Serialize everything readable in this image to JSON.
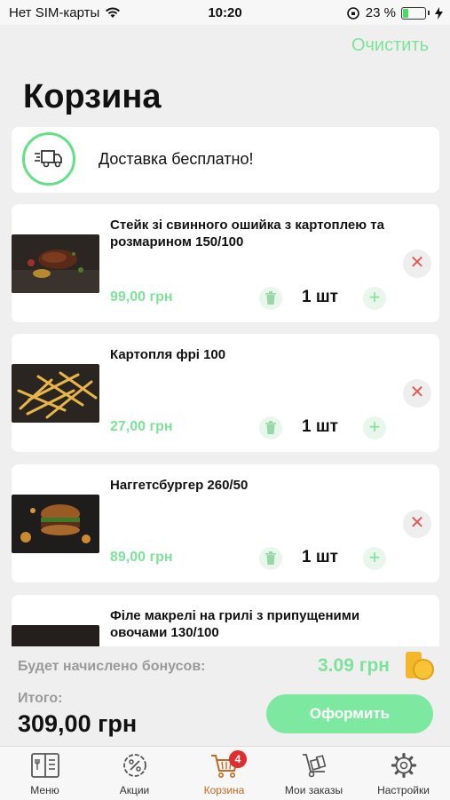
{
  "status_bar": {
    "carrier": "Нет SIM-карты",
    "time": "10:20",
    "battery": "23 %"
  },
  "header": {
    "clear_label": "Очистить",
    "title": "Корзина"
  },
  "delivery": {
    "text": "Доставка бесплатно!"
  },
  "items": [
    {
      "name": "Стейк зі свинного ошийка з  картоплею та розмарином 150/100",
      "price": "99,00 грн",
      "qty": "1 шт"
    },
    {
      "name": "Картопля  фрі 100",
      "price": "27,00 грн",
      "qty": "1 шт"
    },
    {
      "name": "Наггетсбургер 260/50",
      "price": "89,00 грн",
      "qty": "1 шт"
    },
    {
      "name": "Філе макрелі на грилі з припущеними овочами 130/100",
      "price": "",
      "qty": ""
    }
  ],
  "summary": {
    "bonus_label": "Будет начислено бонусов:",
    "bonus_value": "3.09 грн",
    "total_label": "Итого:",
    "total_value": "309,00 грн",
    "checkout_label": "Оформить"
  },
  "tabbar": {
    "items": [
      {
        "label": "Меню",
        "icon": "menu-book-icon"
      },
      {
        "label": "Акции",
        "icon": "percent-badge-icon"
      },
      {
        "label": "Корзина",
        "icon": "cart-icon",
        "badge": "4",
        "active": true
      },
      {
        "label": "Мои заказы",
        "icon": "hand-truck-icon"
      },
      {
        "label": "Настройки",
        "icon": "gear-icon"
      }
    ]
  },
  "colors": {
    "accent_green": "#7de39b",
    "active_tab": "#c2691f",
    "badge_red": "#e02e2e",
    "remove_red": "#e05a5a"
  }
}
